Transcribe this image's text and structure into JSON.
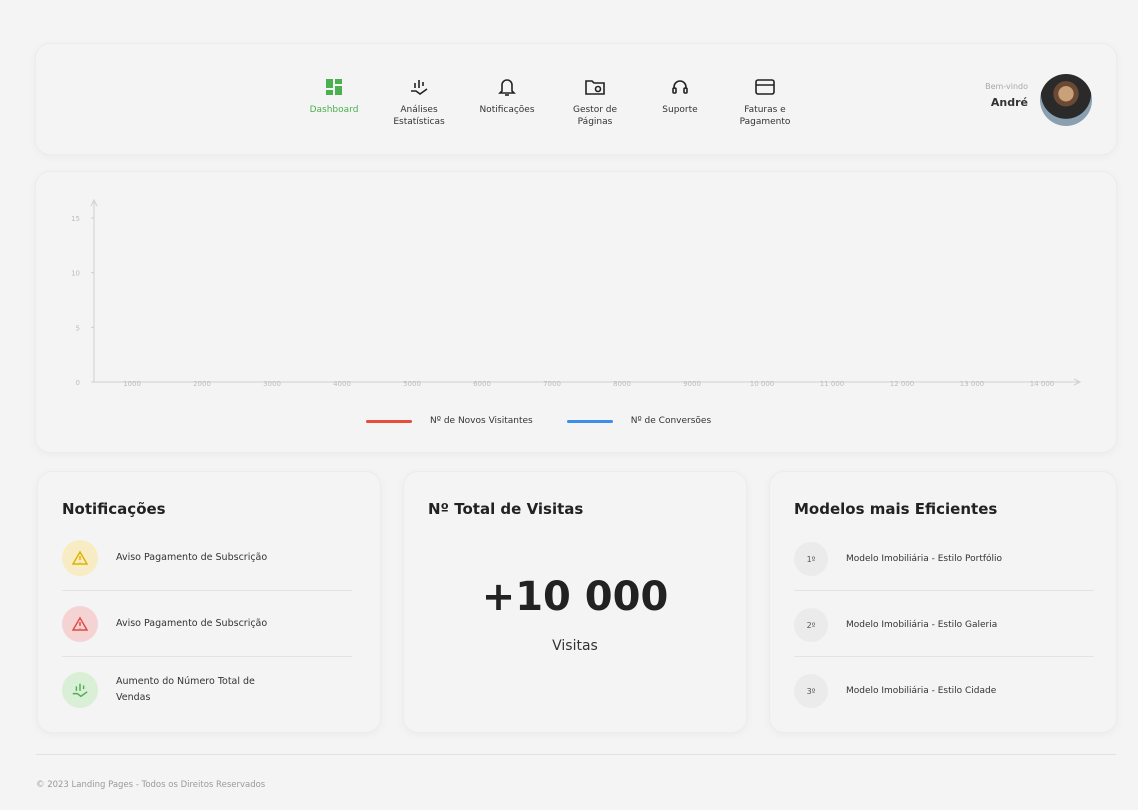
{
  "header": {
    "nav": [
      {
        "label": "Dashboard",
        "icon": "dashboard-icon",
        "active": true
      },
      {
        "label": "Análises\nEstatísticas",
        "icon": "chart-hand-icon",
        "active": false
      },
      {
        "label": "Notificações",
        "icon": "bell-icon",
        "active": false
      },
      {
        "label": "Gestor de\nPáginas",
        "icon": "folder-gear-icon",
        "active": false
      },
      {
        "label": "Suporte",
        "icon": "headset-icon",
        "active": false
      },
      {
        "label": "Faturas e\nPagamento",
        "icon": "credit-card-icon",
        "active": false
      }
    ],
    "welcome_small": "Bem-vindo",
    "user_name": "André"
  },
  "colors": {
    "accent": "#4caf50",
    "series_visitors": "#e74c3c",
    "series_conversions": "#3b8fe6"
  },
  "chart_data": {
    "type": "line",
    "x_ticks": [
      "1000",
      "2000",
      "3000",
      "4000",
      "5000",
      "6000",
      "7000",
      "8000",
      "9000",
      "10 000",
      "11 000",
      "12 000",
      "13 000",
      "14 000"
    ],
    "y_ticks": [
      "0",
      "5",
      "10",
      "15"
    ],
    "series": [
      {
        "name": "Nº de Novos Visitantes",
        "values": []
      },
      {
        "name": "Nº de Conversões",
        "values": []
      }
    ],
    "legend_position": "bottom"
  },
  "notifications": {
    "title": "Notificações",
    "items": [
      {
        "text": "Aviso Pagamento de Subscrição",
        "icon": "warning-icon",
        "bg": "#f7ecc4",
        "fg": "#e0b400"
      },
      {
        "text": "Aviso Pagamento de Subscrição",
        "icon": "warning-icon",
        "bg": "#f6d3d3",
        "fg": "#e14b4b"
      },
      {
        "text": "Aumento do Número Total de Vendas",
        "icon": "growth-icon",
        "bg": "#d9efd6",
        "fg": "#4caf50"
      }
    ]
  },
  "visits": {
    "title": "Nº Total de Visitas",
    "value": "+10 000",
    "unit": "Visitas"
  },
  "models": {
    "title": "Modelos mais Eficientes",
    "items": [
      {
        "rank": "1º",
        "text": "Modelo Imobiliária - Estilo Portfólio"
      },
      {
        "rank": "2º",
        "text": "Modelo Imobiliária - Estilo Galeria"
      },
      {
        "rank": "3º",
        "text": "Modelo Imobiliária - Estilo Cidade"
      }
    ]
  },
  "footer": {
    "text": "© 2023 Landing Pages - Todos os Direitos Reservados"
  }
}
